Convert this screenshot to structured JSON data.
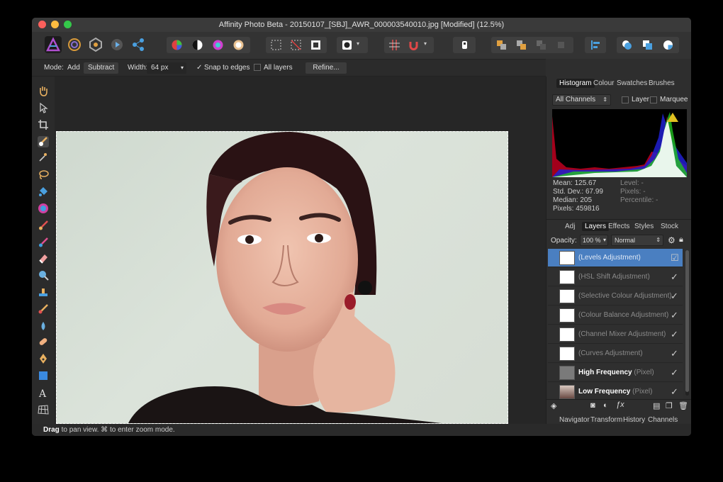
{
  "window": {
    "title": "Affinity Photo Beta - 20150107_[SBJ]_AWR_000003540010.jpg [Modified] (12.5%)"
  },
  "context": {
    "mode_label": "Mode:",
    "add": "Add",
    "subtract": "Subtract",
    "width_label": "Width:",
    "width_value": "64 px",
    "snap": "Snap to edges",
    "all_layers": "All layers",
    "refine": "Refine..."
  },
  "panel_top": {
    "tabs": [
      "Histogram",
      "Colour",
      "Swatches",
      "Brushes"
    ],
    "channel_select": "All Channels",
    "layer_label": "Layer",
    "marquee_label": "Marquee",
    "stats_left": [
      "Mean: 125.67",
      "Std. Dev.: 67.99",
      "Median: 205",
      "Pixels: 459816"
    ],
    "stats_right": [
      "Level: -",
      "Pixels: -",
      "Percentile: -"
    ]
  },
  "panel_mid": {
    "tabs": [
      "Adj",
      "Layers",
      "Effects",
      "Styles",
      "Stock"
    ],
    "opacity_label": "Opacity:",
    "opacity_value": "100 %",
    "blend_mode": "Normal",
    "layers": [
      {
        "name": "(Levels Adjustment)",
        "selected": true
      },
      {
        "name": "(HSL Shift Adjustment)"
      },
      {
        "name": "(Selective Colour Adjustment)"
      },
      {
        "name": "(Colour Balance Adjustment)"
      },
      {
        "name": "(Channel Mixer Adjustment)"
      },
      {
        "name": "(Curves Adjustment)"
      },
      {
        "name": "High Frequency",
        "suffix": "(Pixel)"
      },
      {
        "name": "Low Frequency",
        "suffix": "(Pixel)"
      }
    ]
  },
  "panel_bottom": {
    "tabs": [
      "Navigator",
      "Transform",
      "History",
      "Channels"
    ]
  },
  "status": {
    "bold": "Drag",
    "text": " to pan view. ⌘ to enter zoom mode."
  }
}
